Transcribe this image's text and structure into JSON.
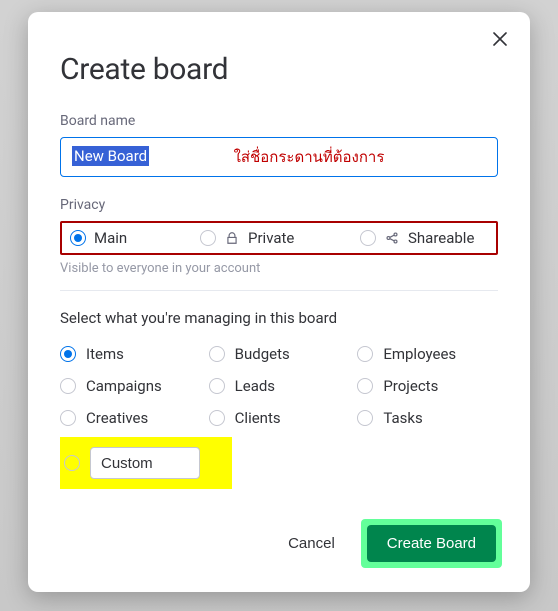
{
  "modal": {
    "title": "Create board",
    "board_name_label": "Board name",
    "board_name_value": "New Board",
    "board_name_annotation": "ใส่ชื่อกระดานที่ต้องการ",
    "privacy_label": "Privacy",
    "privacy_options": [
      {
        "key": "main",
        "label": "Main",
        "selected": true,
        "icon": null
      },
      {
        "key": "private",
        "label": "Private",
        "selected": false,
        "icon": "lock-icon"
      },
      {
        "key": "shareable",
        "label": "Shareable",
        "selected": false,
        "icon": "share-icon"
      }
    ],
    "privacy_hint": "Visible to everyone in your account",
    "managing_label": "Select what you're managing in this board",
    "managing_options": [
      {
        "label": "Items",
        "selected": true
      },
      {
        "label": "Budgets",
        "selected": false
      },
      {
        "label": "Employees",
        "selected": false
      },
      {
        "label": "Campaigns",
        "selected": false
      },
      {
        "label": "Leads",
        "selected": false
      },
      {
        "label": "Projects",
        "selected": false
      },
      {
        "label": "Creatives",
        "selected": false
      },
      {
        "label": "Clients",
        "selected": false
      },
      {
        "label": "Tasks",
        "selected": false
      }
    ],
    "custom_option": {
      "selected": false,
      "value": "Custom"
    },
    "footer": {
      "cancel_label": "Cancel",
      "create_label": "Create Board"
    }
  },
  "colors": {
    "primary": "#0073ea",
    "success": "#00854d",
    "highlight_green": "#63ff9a",
    "highlight_yellow": "#ffff00",
    "annotation_red": "#a80000"
  }
}
